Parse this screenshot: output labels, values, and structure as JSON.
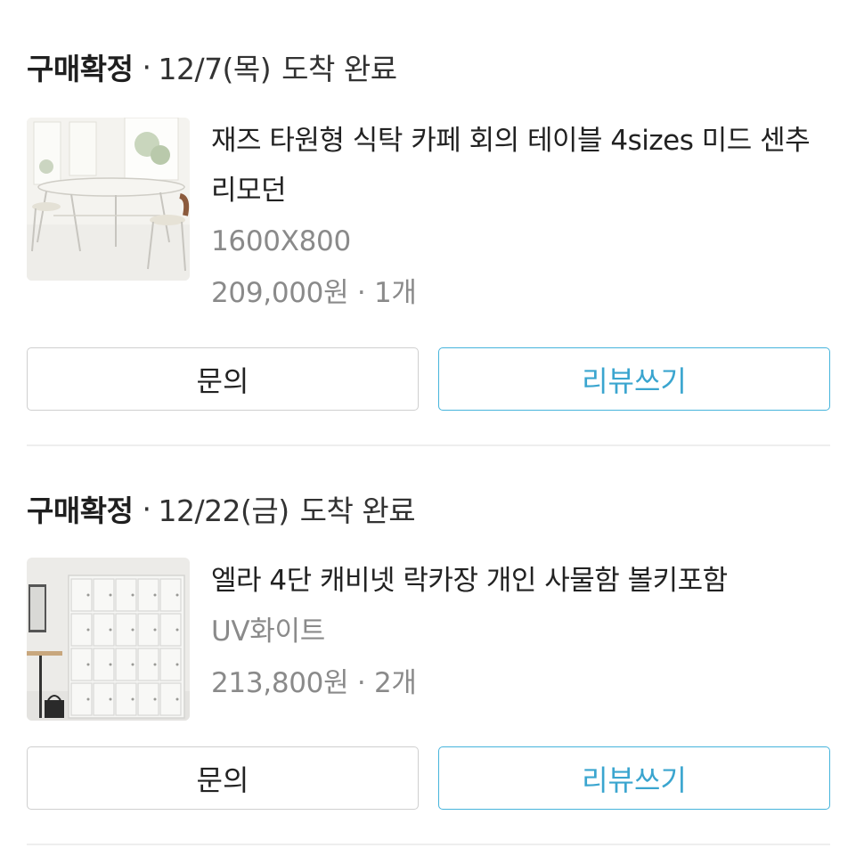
{
  "orders": [
    {
      "status": "구매확정",
      "separator": "·",
      "date": "12/7(목)",
      "arrival": "도착 완료",
      "product": {
        "name": "재즈 타원형 식탁 카페 회의 테이블 4sizes 미드 센추리모던",
        "option": "1600X800",
        "price": "209,000원 · 1개",
        "thumbnail_icon": "dining-table-photo"
      },
      "buttons": {
        "inquiry": "문의",
        "review": "리뷰쓰기"
      }
    },
    {
      "status": "구매확정",
      "separator": "·",
      "date": "12/22(금)",
      "arrival": "도착 완료",
      "product": {
        "name": "엘라 4단 캐비넷 락카장 개인 사물함 볼키포함",
        "option": "UV화이트",
        "price": "213,800원 · 2개",
        "thumbnail_icon": "locker-cabinet-photo"
      },
      "buttons": {
        "inquiry": "문의",
        "review": "리뷰쓰기"
      }
    }
  ],
  "colors": {
    "review_accent": "#3aa5cf",
    "muted_text": "#8a8a8a",
    "border": "#cfcfcf"
  }
}
